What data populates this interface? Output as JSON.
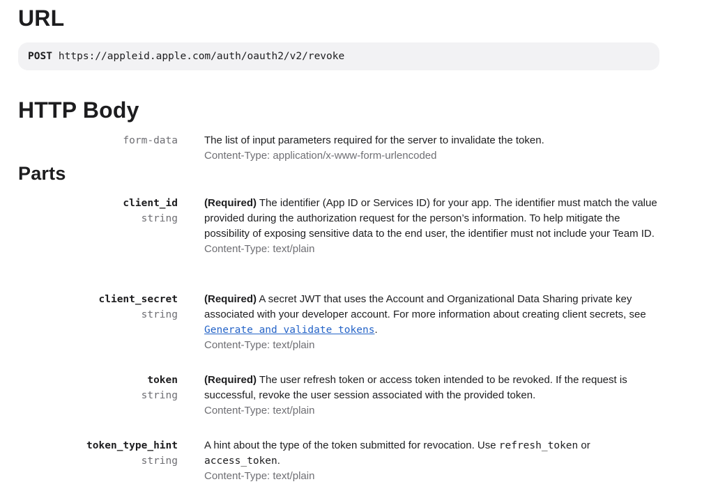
{
  "url_section": {
    "title": "URL",
    "method": "POST",
    "endpoint": "https://appleid.apple.com/auth/oauth2/v2/revoke"
  },
  "http_body": {
    "title": "HTTP Body",
    "name": "form-data",
    "description": "The list of input parameters required for the server to invalidate the token.",
    "content_type": "Content-Type: application/x-www-form-urlencoded"
  },
  "parts": {
    "title": "Parts",
    "client_id": {
      "name": "client_id",
      "type": "string",
      "required_label": "(Required)",
      "description": " The identifier (App ID or Services ID) for your app. The identifier must match the value provided during the authorization request for the person’s information. To help mitigate the possibility of exposing sensitive data to the end user, the identifier must not include your Team ID.",
      "content_type": "Content-Type: text/plain"
    },
    "client_secret": {
      "name": "client_secret",
      "type": "string",
      "required_label": "(Required)",
      "description": " A secret JWT that uses the Account and Organizational Data Sharing private key associated with your developer account. For more information about creating client secrets, see ",
      "link_text": "Generate and validate tokens",
      "description_end": ".",
      "content_type": "Content-Type: text/plain"
    },
    "token": {
      "name": "token",
      "type": "string",
      "required_label": "(Required)",
      "description": " The user refresh token or access token intended to be revoked. If the request is successful, revoke the user session associated with the provided token.",
      "content_type": "Content-Type: text/plain"
    },
    "token_type_hint": {
      "name": "token_type_hint",
      "type": "string",
      "description_start": "A hint about the type of the token submitted for revocation. Use ",
      "code_1": "refresh_token",
      "description_mid": " or ",
      "code_2": "access_token",
      "description_end": ".",
      "content_type": "Content-Type: text/plain"
    }
  }
}
